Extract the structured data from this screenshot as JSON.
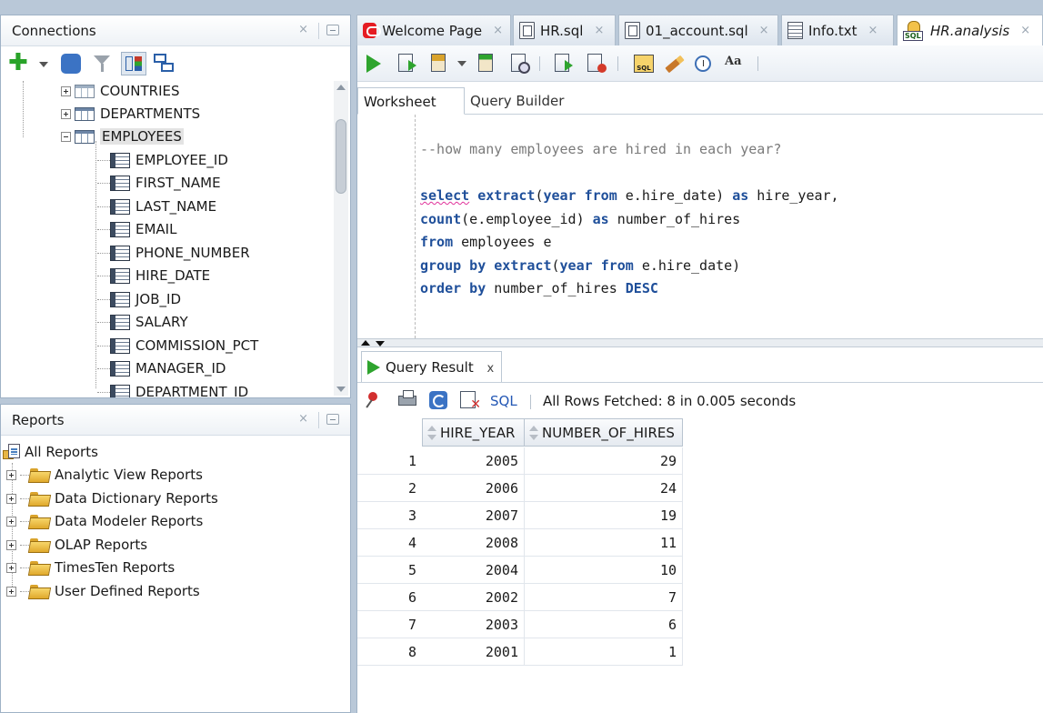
{
  "connections_panel": {
    "title": "Connections",
    "tree": [
      {
        "label": "COUNTRIES",
        "type": "table",
        "expanded": false
      },
      {
        "label": "DEPARTMENTS",
        "type": "table",
        "expanded": false
      },
      {
        "label": "EMPLOYEES",
        "type": "table",
        "expanded": true,
        "selected": true
      }
    ],
    "columns": [
      "EMPLOYEE_ID",
      "FIRST_NAME",
      "LAST_NAME",
      "EMAIL",
      "PHONE_NUMBER",
      "HIRE_DATE",
      "JOB_ID",
      "SALARY",
      "COMMISSION_PCT",
      "MANAGER_ID",
      "DEPARTMENT_ID"
    ]
  },
  "reports_panel": {
    "title": "Reports",
    "root": "All Reports",
    "items": [
      "Analytic View Reports",
      "Data Dictionary Reports",
      "Data Modeler Reports",
      "OLAP Reports",
      "TimesTen Reports",
      "User Defined Reports"
    ]
  },
  "tabs": [
    {
      "label": "Welcome Page",
      "icon": "oracle-icon"
    },
    {
      "label": "HR.sql",
      "icon": "sql-file-icon"
    },
    {
      "label": "01_account.sql",
      "icon": "sql-file-icon"
    },
    {
      "label": "Info.txt",
      "icon": "text-file-icon"
    },
    {
      "label": "HR.analysis",
      "icon": "sql-worksheet-icon",
      "active": true
    }
  ],
  "worksheet": {
    "subtabs": [
      "Worksheet",
      "Query Builder"
    ],
    "comment": "--how many employees are hired in each year?"
  },
  "result": {
    "tab_label": "Query Result",
    "tab_close": "x",
    "sql_link": "SQL",
    "status": "All Rows Fetched: 8 in 0.005 seconds",
    "headers": [
      "HIRE_YEAR",
      "NUMBER_OF_HIRES"
    ],
    "rows": [
      {
        "n": "1",
        "year": "2005",
        "hires": "29"
      },
      {
        "n": "2",
        "year": "2006",
        "hires": "24"
      },
      {
        "n": "3",
        "year": "2007",
        "hires": "19"
      },
      {
        "n": "4",
        "year": "2008",
        "hires": "11"
      },
      {
        "n": "5",
        "year": "2004",
        "hires": "10"
      },
      {
        "n": "6",
        "year": "2002",
        "hires": "7"
      },
      {
        "n": "7",
        "year": "2003",
        "hires": "6"
      },
      {
        "n": "8",
        "year": "2001",
        "hires": "1"
      }
    ]
  },
  "code": {
    "l1": {
      "kw1": "select",
      "kw2": "extract",
      "p1": "(",
      "kw3": "year",
      "kw4": "from",
      "t1": " e.hire_date) ",
      "kw5": "as",
      "t2": " hire_year,"
    },
    "l2": {
      "kw1": "count",
      "t1": "(e.employee_id) ",
      "kw2": "as",
      "t2": " number_of_hires"
    },
    "l3": {
      "kw1": "from",
      "t1": " employees e"
    },
    "l4": {
      "kw1": "group by",
      "kw2": "extract",
      "p1": "(",
      "kw3": "year",
      "kw4": "from",
      "t1": " e.hire_date)"
    },
    "l5": {
      "kw1": "order by",
      "t1": " number_of_hires ",
      "kw2": "DESC"
    }
  },
  "ui": {
    "close_glyph": "×"
  }
}
